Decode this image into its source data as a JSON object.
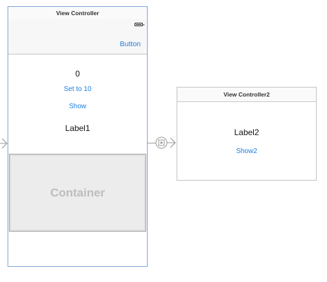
{
  "view_controller": {
    "title": "View Controller",
    "nav_button_label": "Button",
    "label_value": "0",
    "set_button_label": "Set to 10",
    "show_button_label": "Show",
    "label1": "Label1",
    "container_label": "Container"
  },
  "view_controller2": {
    "title": "View Controller2",
    "label2": "Label2",
    "show2_button_label": "Show2"
  },
  "icons": [
    "battery-icon",
    "segue-icon",
    "entry-arrow-icon"
  ],
  "colors": {
    "accent": "#1f7de0",
    "scene_border_selected": "#7fa7d6",
    "container_fill": "#ececec"
  }
}
